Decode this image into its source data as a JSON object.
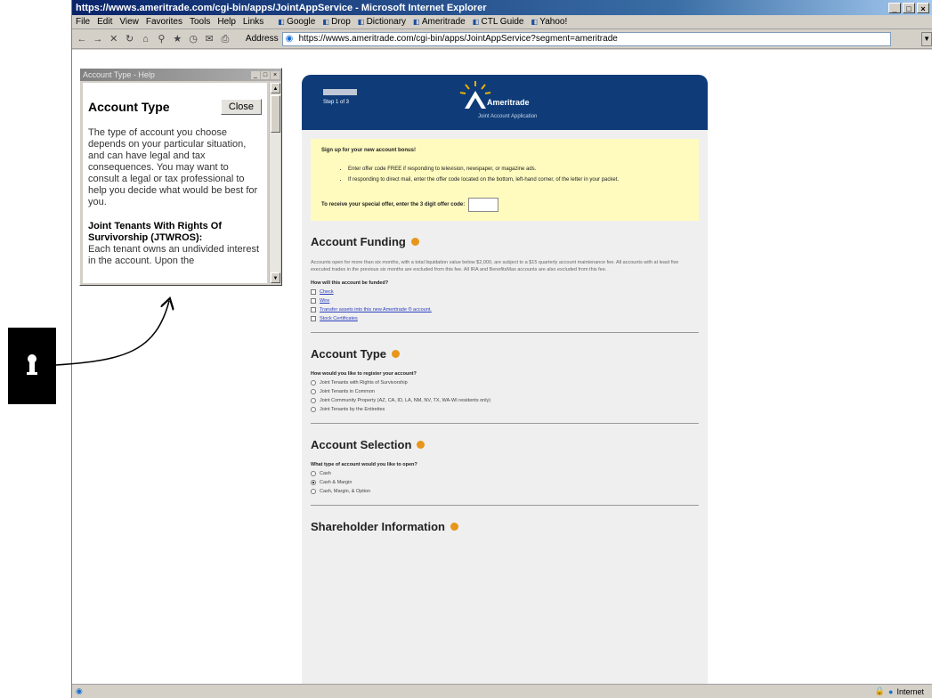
{
  "window": {
    "title": "https://wwws.ameritrade.com/cgi-bin/apps/JointAppService - Microsoft Internet Explorer",
    "controls": [
      "_",
      "□",
      "×"
    ]
  },
  "menu": {
    "items": [
      "File",
      "Edit",
      "View",
      "Favorites",
      "Tools",
      "Help"
    ],
    "links_label": "Links",
    "links": [
      "Google",
      "Drop",
      "Dictionary",
      "Ameritrade",
      "CTL Guide",
      "Yahoo!"
    ]
  },
  "toolbar": {
    "address_label": "Address",
    "address_url": "https://wwws.ameritrade.com/cgi-bin/apps/JointAppService?segment=ameritrade"
  },
  "help_popup": {
    "window_title": "Account Type - Help",
    "title": "Account Type",
    "close_label": "Close",
    "body": "The type of account you choose depends on your particular situation, and can have legal and tax consequences. You may want to consult a legal or tax professional to help you decide what would be best for you.",
    "subheading": "Joint Tenants With Rights Of Survivorship (JTWROS):",
    "subtext": "Each tenant owns an undivided interest in the account. Upon the"
  },
  "banner": {
    "step": "Step 1 of 3",
    "brand": "Ameritrade",
    "subtitle": "Joint Account Application"
  },
  "promo": {
    "heading": "Sign up for your new account bonus!",
    "bullets": [
      "Enter offer code FREE if responding to television, newspaper, or magazine ads.",
      "If responding to direct mail, enter the offer code located on the bottom, left-hand corner, of the letter in your packet."
    ],
    "offer_label": "To receive your special offer, enter the 3 digit offer code:"
  },
  "funding": {
    "heading": "Account Funding",
    "description": "Accounts open for more than six months, with a total liquidation value below $2,000, are subject to a $15 quarterly account maintenance fee. All accounts with at least five executed trades in the previous six months are excluded from this fee. All IRA and BenefitsMax accounts are also excluded from this fee.",
    "question": "How will this account be funded?",
    "options": [
      "Check",
      "Wire",
      "Transfer assets into this new Ameritrade ® account.",
      "Stock Certificates"
    ]
  },
  "account_type": {
    "heading": "Account Type",
    "question": "How would you like to register your account?",
    "options": [
      "Joint Tenants with Rights of Survivorship",
      "Joint Tenants in Common",
      "Joint Community Property (AZ, CA, ID, LA, NM, NV, TX, WA-WI residents only)",
      "Joint Tenants by the Entireties"
    ]
  },
  "account_selection": {
    "heading": "Account Selection",
    "question": "What type of account would you like to open?",
    "options": [
      "Cash",
      "Cash & Margin",
      "Cash, Margin, & Option"
    ],
    "selected_index": 1
  },
  "shareholder": {
    "heading": "Shareholder Information"
  },
  "status": {
    "zone": "Internet"
  },
  "colors": {
    "banner": "#0f3c78",
    "promo_bg": "#fffbbf",
    "help_icon": "#e8961a"
  }
}
